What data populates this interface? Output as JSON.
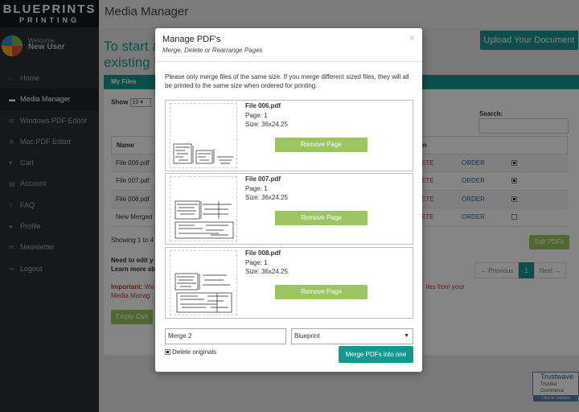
{
  "sidebar": {
    "logo_line1": "BLUEPRINTS",
    "logo_line2": "PRINTING",
    "welcome": "Welcome",
    "username": "New User",
    "items": [
      {
        "label": "Home",
        "icon": "home-icon",
        "glyph": "⌂"
      },
      {
        "label": "Media Manager",
        "icon": "folder-icon",
        "glyph": "▬"
      },
      {
        "label": "Windows PDF Editor",
        "icon": "gears-icon",
        "glyph": "✲"
      },
      {
        "label": "Mac PDF Editor",
        "icon": "gears-icon",
        "glyph": "✲"
      },
      {
        "label": "Cart",
        "icon": "cart-icon",
        "glyph": "▾"
      },
      {
        "label": "Account",
        "icon": "book-icon",
        "glyph": "▤"
      },
      {
        "label": "FAQ",
        "icon": "question-icon",
        "glyph": "?"
      },
      {
        "label": "Profile",
        "icon": "user-icon",
        "glyph": "●"
      },
      {
        "label": "Newsletter",
        "icon": "envelope-icon",
        "glyph": "✉"
      },
      {
        "label": "Logout",
        "icon": "signout-icon",
        "glyph": "↪"
      }
    ]
  },
  "main": {
    "title": "Media Manager",
    "big_title": "To start a existing",
    "upload_label": "Upload Your Document",
    "tab_label": "My Files",
    "show_label": "Show",
    "show_value": "10",
    "search_label": "Search:",
    "table": {
      "headers": {
        "name": "Name",
        "action": "on"
      },
      "rows": [
        {
          "name": "File 006.pdf",
          "del": "ETE",
          "order": "ORDER",
          "checked": true
        },
        {
          "name": "File 007.pdf",
          "del": "ETE",
          "order": "ORDER",
          "checked": true
        },
        {
          "name": "File 008.pdf",
          "del": "ETE",
          "order": "ORDER",
          "checked": true
        },
        {
          "name": "New Merged",
          "del": "ETE",
          "order": "ORDER",
          "checked": false
        }
      ]
    },
    "showing": "Showing 1 to 4",
    "edit_pdfs": "Edit PDFs",
    "pager": {
      "prev": "← Previous",
      "current": "1",
      "next": "Next →"
    },
    "note_line1": "Need to edit y",
    "note_line2": "Learn more ab",
    "important_prefix": "Important:",
    "important_text": " We",
    "important_right": "iles from your",
    "important_line2": "Media Manag",
    "empty_cart": "Empty Cart",
    "trust": {
      "name": "Trustwave",
      "sub": "Trusted Commerce",
      "link": "Click to Validate"
    }
  },
  "modal": {
    "title": "Manage PDF's",
    "subtitle": "Merge, Delete or Rearrange Pages",
    "close": "×",
    "warning": "Please only merge files of the same size. If you merge different sized files, they will all be printed to the same size when ordered for printing.",
    "files": [
      {
        "name": "File 006.pdf",
        "page": "Page: 1",
        "size": "Size: 36x24.25",
        "remove": "Remove Page"
      },
      {
        "name": "File 007.pdf",
        "page": "Page: 1",
        "size": "Size: 36x24.25",
        "remove": "Remove Page"
      },
      {
        "name": "File 008.pdf",
        "page": "Page: 1",
        "size": "Size: 36x24.25",
        "remove": "Remove Page"
      }
    ],
    "merge_name": "Merge 2",
    "type_value": "Blueprint",
    "delete_originals": "Delete originals",
    "merge_button": "Merge PDFs into one"
  },
  "colors": {
    "teal": "#16968f",
    "green": "#9cc561",
    "sidebar": "#2b2f33",
    "danger": "#c0392b"
  }
}
